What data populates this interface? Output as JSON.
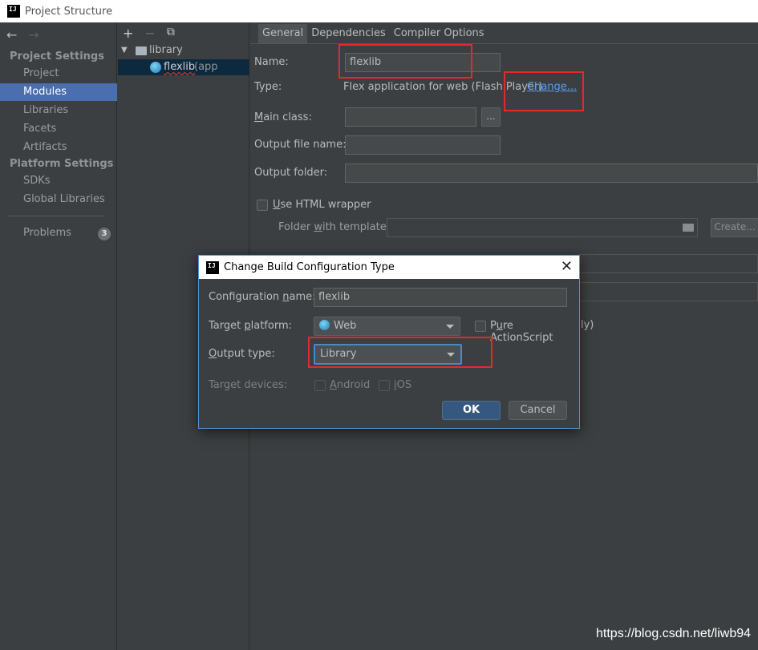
{
  "window": {
    "title": "Project Structure",
    "logo_text": "IJ"
  },
  "sidebar": {
    "back_icon": "←",
    "forward_icon": "→",
    "project_settings_header": "Project Settings",
    "platform_settings_header": "Platform Settings",
    "items": [
      {
        "label": "Project"
      },
      {
        "label": "Modules"
      },
      {
        "label": "Libraries"
      },
      {
        "label": "Facets"
      },
      {
        "label": "Artifacts"
      },
      {
        "label": "SDKs"
      },
      {
        "label": "Global Libraries"
      },
      {
        "label": "Problems",
        "badge": "3"
      }
    ]
  },
  "tree": {
    "add_icon": "+",
    "remove_icon": "−",
    "copy_icon": "⧉",
    "expand_icon": "▼",
    "root_label": "library",
    "child_label": "flexlib",
    "child_suffix": "(app"
  },
  "tabs": [
    "General",
    "Dependencies",
    "Compiler Options"
  ],
  "general": {
    "name_label": "Name:",
    "name_value": "flexlib",
    "type_label": "Type:",
    "type_value": "Flex application for web (Flash Player)",
    "change_link": "Change...",
    "main_class_label_u": "M",
    "main_class_label_rest": "ain class:",
    "browse_label": "...",
    "output_file_label": "Output file name:",
    "output_folder_label": "Output folder:",
    "html_wrapper_label_u": "U",
    "html_wrapper_label_rest": "se HTML wrapper",
    "folder_template_label_a": "Folder ",
    "folder_template_label_u": "w",
    "folder_template_label_b": "ith template:",
    "create_button": "Create...",
    "partial_text": "ly)"
  },
  "dialog": {
    "title": "Change Build Configuration Type",
    "close_icon": "✕",
    "config_name_label_a": "Configuration ",
    "config_name_label_u": "n",
    "config_name_label_b": "ame:",
    "config_name_value": "flexlib",
    "target_platform_label_a": "Target ",
    "target_platform_label_u": "p",
    "target_platform_label_b": "latform:",
    "target_platform_value": "Web",
    "pure_as_label_u": "u",
    "pure_as_label_a": "P",
    "pure_as_label_b": "re ActionScript",
    "output_type_label_u": "O",
    "output_type_label_rest": "utput type:",
    "output_type_value": "Library",
    "target_devices_label": "Target devices:",
    "android_label_u": "A",
    "android_label_rest": "ndroid",
    "ios_label_u": "i",
    "ios_label_rest": "OS",
    "ok_button": "OK",
    "cancel_button": "Cancel"
  },
  "watermark": "https://blog.csdn.net/liwb94",
  "colors": {
    "highlight_box": "#e5292b",
    "selection": "#4b6eaf",
    "link": "#589df6"
  }
}
